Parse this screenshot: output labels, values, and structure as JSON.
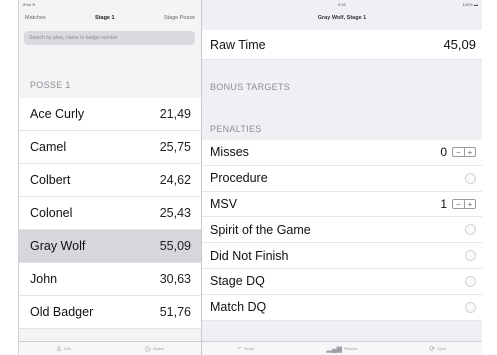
{
  "statusbar": {
    "left": "iPad ≋",
    "center": "9:42",
    "right": "100% ▬"
  },
  "left_nav": {
    "back": "Matches",
    "title": "Stage 1",
    "right": "Stage Posse"
  },
  "search": {
    "placeholder": "Search by alias, name or badge number"
  },
  "posse": {
    "header": "POSSE 1",
    "shooters": [
      {
        "name": "Ace Curly",
        "time": "21,49",
        "selected": false
      },
      {
        "name": "Camel",
        "time": "25,75",
        "selected": false
      },
      {
        "name": "Colbert",
        "time": "24,62",
        "selected": false
      },
      {
        "name": "Colonel",
        "time": "25,43",
        "selected": false
      },
      {
        "name": "Gray Wolf",
        "time": "55,09",
        "selected": true
      },
      {
        "name": "John",
        "time": "30,63",
        "selected": false
      },
      {
        "name": "Old Badger",
        "time": "51,76",
        "selected": false
      }
    ]
  },
  "detail": {
    "title": "Gray Wolf, Stage 1",
    "raw_time_label": "Raw Time",
    "raw_time_value": "45,09",
    "bonus_header": "BONUS TARGETS",
    "penalties_header": "PENALTIES",
    "penalties": [
      {
        "label": "Misses",
        "kind": "stepper",
        "count": "0"
      },
      {
        "label": "Procedure",
        "kind": "toggle"
      },
      {
        "label": "MSV",
        "kind": "stepper",
        "count": "1"
      },
      {
        "label": "Spirit of the Game",
        "kind": "toggle"
      },
      {
        "label": "Did Not Finish",
        "kind": "toggle"
      },
      {
        "label": "Stage DQ",
        "kind": "toggle"
      },
      {
        "label": "Match DQ",
        "kind": "toggle"
      }
    ]
  },
  "tabs": [
    {
      "label": "Info",
      "icon": "person-icon",
      "glyph": "♙"
    },
    {
      "label": "Status",
      "icon": "clock-icon",
      "glyph": "◷"
    },
    {
      "label": "Score",
      "icon": "gun-icon",
      "glyph": "⌐"
    },
    {
      "label": "Results",
      "icon": "chart-icon",
      "glyph": "▂▄▆"
    },
    {
      "label": "Sync",
      "icon": "sync-icon",
      "glyph": "⟳"
    }
  ]
}
